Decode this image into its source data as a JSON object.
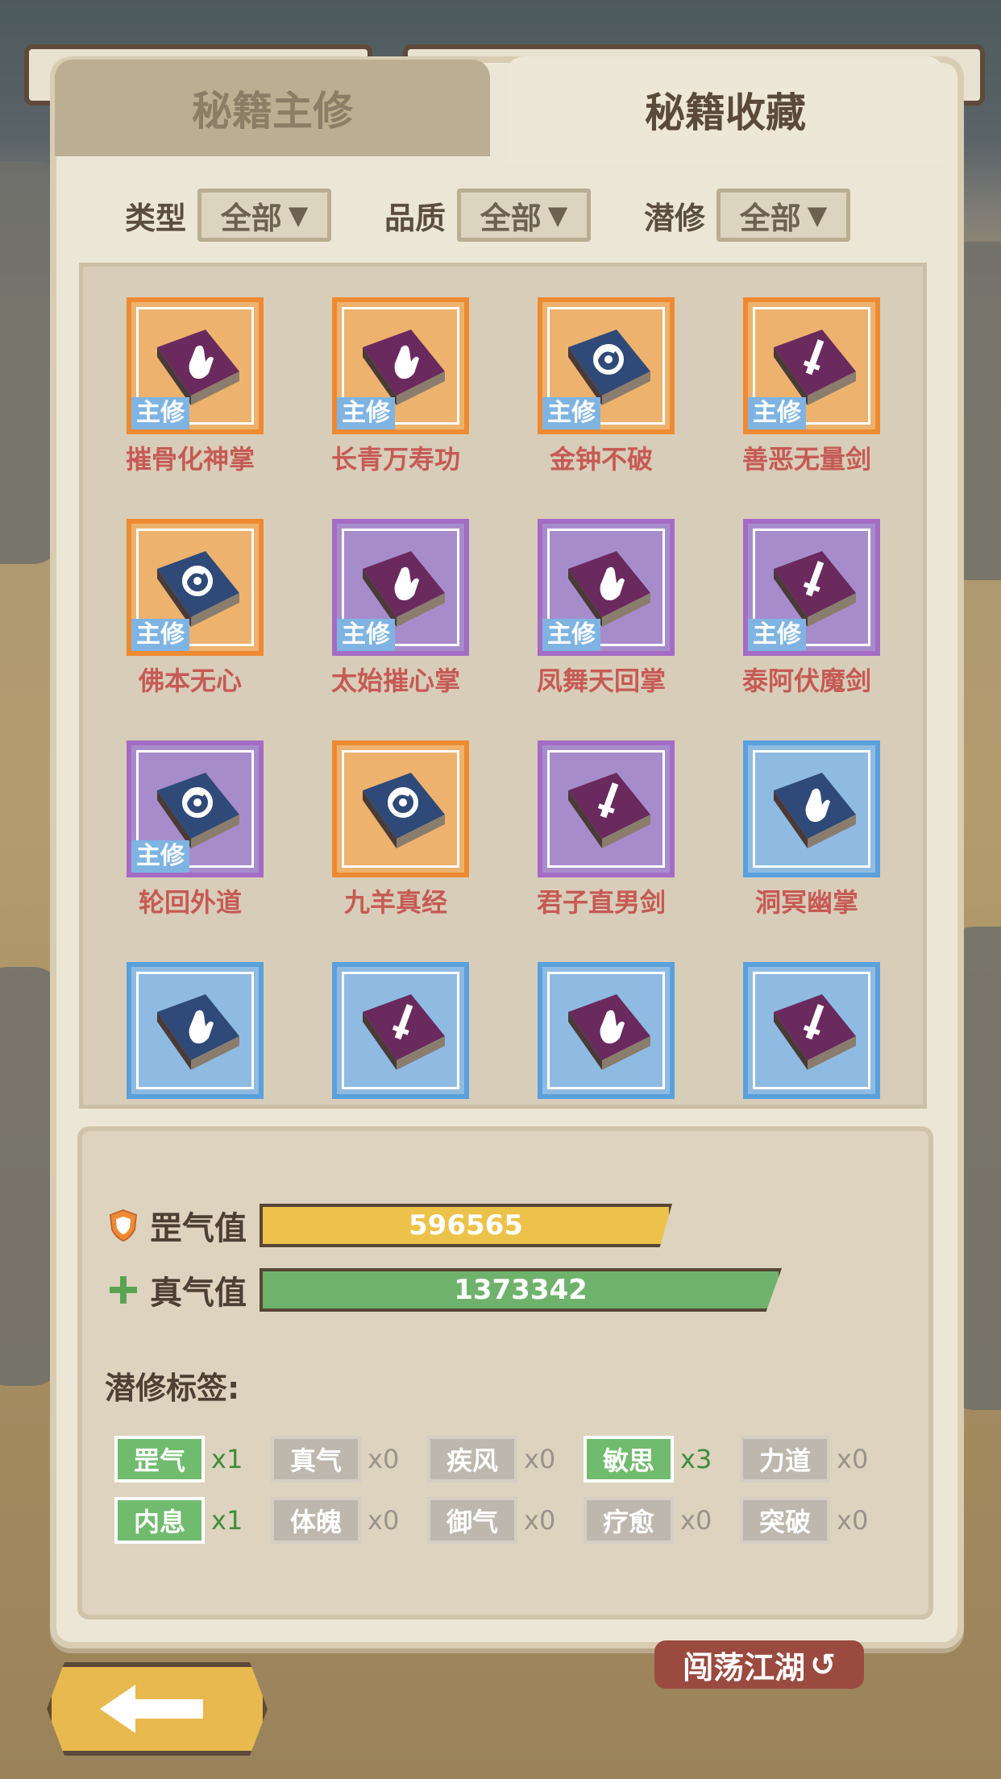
{
  "tabs": {
    "main": "秘籍主修",
    "collection": "秘籍收藏"
  },
  "filters": {
    "type_label": "类型",
    "type_value": "全部",
    "quality_label": "品质",
    "quality_value": "全部",
    "latent_label": "潜修",
    "latent_value": "全部",
    "arrow": "▼"
  },
  "main_tag": "主修",
  "items": [
    {
      "name": "摧骨化神掌",
      "quality": "orange",
      "icon": "palm",
      "cover": "purple",
      "main": true
    },
    {
      "name": "长青万寿功",
      "quality": "orange",
      "icon": "palm",
      "cover": "purple",
      "main": true
    },
    {
      "name": "金钟不破",
      "quality": "orange",
      "icon": "swirl",
      "cover": "navy",
      "main": true
    },
    {
      "name": "善恶无量剑",
      "quality": "orange",
      "icon": "sword",
      "cover": "purple",
      "main": true
    },
    {
      "name": "佛本无心",
      "quality": "orange",
      "icon": "swirl",
      "cover": "navy",
      "main": true
    },
    {
      "name": "太始摧心掌",
      "quality": "purple",
      "icon": "palm",
      "cover": "purple",
      "main": true
    },
    {
      "name": "凤舞天回掌",
      "quality": "purple",
      "icon": "palm",
      "cover": "purple",
      "main": true
    },
    {
      "name": "泰阿伏魔剑",
      "quality": "purple",
      "icon": "sword",
      "cover": "purple",
      "main": true
    },
    {
      "name": "轮回外道",
      "quality": "purple",
      "icon": "swirl",
      "cover": "navy",
      "main": true
    },
    {
      "name": "九羊真经",
      "quality": "orange",
      "icon": "swirl",
      "cover": "navy",
      "main": false
    },
    {
      "name": "君子直男剑",
      "quality": "purple",
      "icon": "sword",
      "cover": "purple",
      "main": false
    },
    {
      "name": "洞冥幽掌",
      "quality": "blue",
      "icon": "palm",
      "cover": "navy",
      "main": false
    },
    {
      "name": "",
      "quality": "blue",
      "icon": "palm",
      "cover": "navy",
      "main": false
    },
    {
      "name": "",
      "quality": "blue",
      "icon": "sword",
      "cover": "purple",
      "main": false
    },
    {
      "name": "",
      "quality": "blue",
      "icon": "palm",
      "cover": "purple",
      "main": false
    },
    {
      "name": "",
      "quality": "blue",
      "icon": "sword",
      "cover": "purple",
      "main": false
    }
  ],
  "stats": {
    "gang_label": "罡气值",
    "gang_value": "596565",
    "gang_fill": 0.9,
    "zhen_label": "真气值",
    "zhen_value": "1373342",
    "zhen_fill": 1.0
  },
  "latent_tags_title": "潜修标签:",
  "latent_tags": [
    {
      "label": "罡气",
      "count": "x1",
      "active": true
    },
    {
      "label": "真气",
      "count": "x0",
      "active": false
    },
    {
      "label": "疾风",
      "count": "x0",
      "active": false
    },
    {
      "label": "敏思",
      "count": "x3",
      "active": true
    },
    {
      "label": "力道",
      "count": "x0",
      "active": false
    },
    {
      "label": "内息",
      "count": "x1",
      "active": true
    },
    {
      "label": "体魄",
      "count": "x0",
      "active": false
    },
    {
      "label": "御气",
      "count": "x0",
      "active": false
    },
    {
      "label": "疗愈",
      "count": "x0",
      "active": false
    },
    {
      "label": "突破",
      "count": "x0",
      "active": false
    }
  ],
  "roam_label": "闯荡江湖",
  "colors": {
    "orange": "#ee8a32",
    "orange_bg": "#edb26e",
    "purple": "#a46cc4",
    "purple_bg": "#a78ccc",
    "blue": "#5aa0dc",
    "blue_bg": "#8fbbe2",
    "gang_bar": "#ecc24a",
    "zhen_bar": "#6fb26c"
  }
}
